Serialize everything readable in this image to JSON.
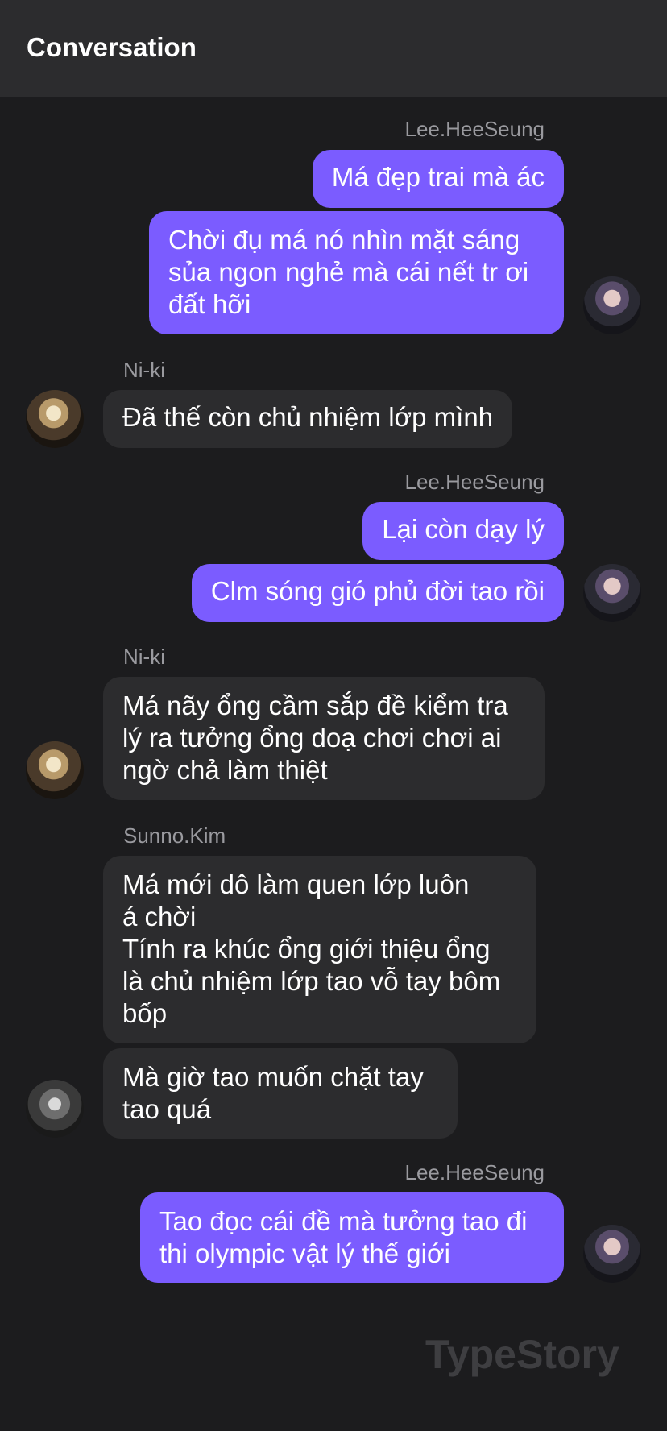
{
  "header": {
    "title": "Conversation"
  },
  "messages": [
    {
      "sender": "Lee.HeeSeung",
      "lines": [
        "Má đẹp trai mà ác"
      ]
    },
    {
      "sender": "Lee.HeeSeung",
      "lines": [
        "Chời đụ má nó nhìn mặt sáng",
        "sủa ngon nghẻ mà cái nết tr ơi",
        "đất hỡi"
      ]
    },
    {
      "sender": "Ni-ki",
      "lines": [
        "Đã thế còn chủ nhiệm lớp mình"
      ]
    },
    {
      "sender": "Lee.HeeSeung",
      "lines": [
        "Lại còn dạy lý"
      ]
    },
    {
      "sender": "Lee.HeeSeung",
      "lines": [
        "Clm sóng gió phủ đời tao rồi"
      ]
    },
    {
      "sender": "Ni-ki",
      "lines": [
        "Má nãy ổng cầm sắp đề kiểm tra",
        "lý ra tưởng ổng doạ chơi chơi ai",
        "ngờ chả làm thiệt"
      ]
    },
    {
      "sender": "Sunno.Kim",
      "lines": [
        "Má mới dô làm quen lớp luôn",
        "á chời",
        "Tính ra khúc ổng giới thiệu ổng",
        "là chủ nhiệm lớp tao vỗ tay bôm",
        "bốp"
      ]
    },
    {
      "sender": "Sunno.Kim",
      "lines": [
        "Mà giờ tao muốn chặt tay",
        "tao quá"
      ]
    },
    {
      "sender": "Lee.HeeSeung",
      "lines": [
        "Tao đọc cái đề mà tưởng tao đi",
        "thi olympic vật lý thế giới"
      ]
    }
  ],
  "watermark": "TypeStory",
  "colors": {
    "outgoing": "#7b5cff",
    "incoming": "#2c2c2e",
    "background": "#1c1c1e"
  }
}
